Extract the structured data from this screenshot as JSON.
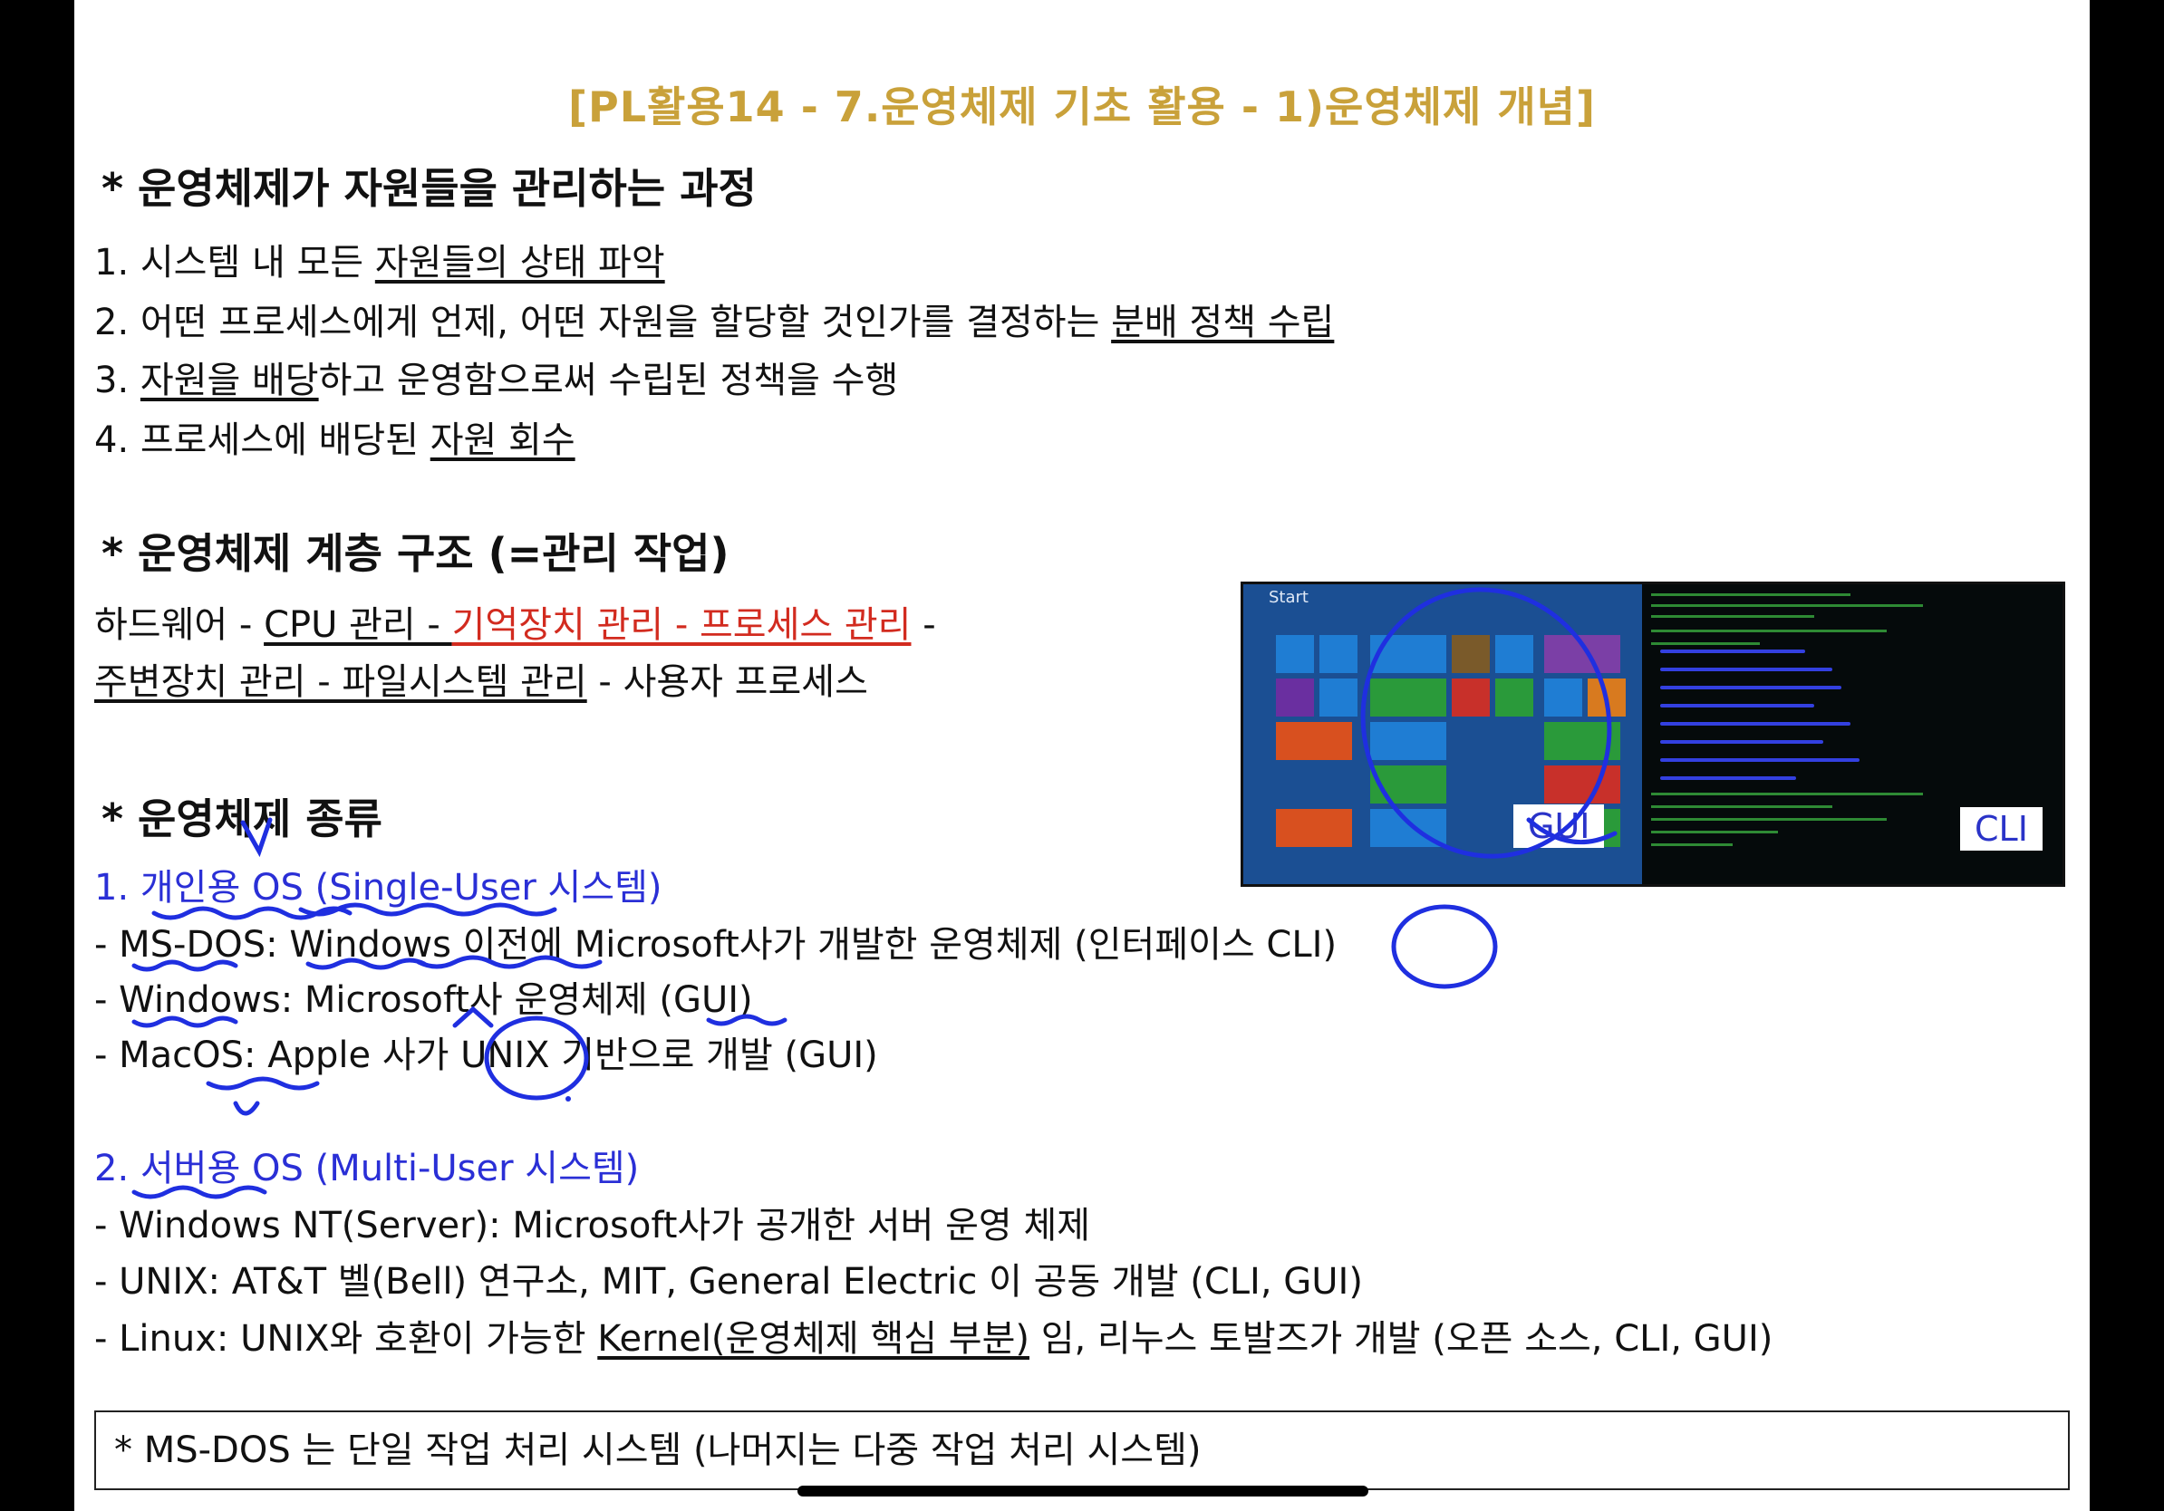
{
  "title": "[PL활용14 - 7.운영체제 기초 활용 - 1)운영체제 개념]",
  "section1": {
    "heading_star": "*",
    "heading": "운영체제가 자원들을 관리하는 과정",
    "items": [
      {
        "prefix": "1. 시스템 내 모든 ",
        "u": "자원들의 상태 파악",
        "suffix": ""
      },
      {
        "prefix": "2. 어떤 프로세스에게 언제, 어떤 자원을 할당할 것인가를 결정하는 ",
        "u": "분배 정책 수립",
        "suffix": ""
      },
      {
        "prefix": "3. ",
        "u": "자원을 배당",
        "suffix": "하고 운영함으로써 수립된 정책을 수행"
      },
      {
        "prefix": "4. 프로세스에 배당된 ",
        "u": "자원 회수",
        "suffix": ""
      }
    ]
  },
  "section2": {
    "heading_star": "*",
    "heading": "운영체제 계층 구조 (=관리 작업)",
    "line1": {
      "a": "하드웨어 - ",
      "b": "CPU 관리 - ",
      "c": "기억장치 관리 - 프로세스 관리",
      "d": " -"
    },
    "line2": {
      "a": "주변장치 관리 - 파일시스템 관리",
      "b": " - 사용자 프로세스"
    }
  },
  "section3": {
    "heading_star": "*",
    "heading": "운영체제 종류",
    "personal_heading": "1. 개인용 OS (Single-User 시스템)",
    "personal_items": [
      "- MS-DOS: Windows 이전에 Microsoft사가 개발한 운영체제 (인터페이스 CLI)",
      "- Windows: Microsoft사 운영체제 (GUI)",
      "- MacOS: Apple 사가 UNIX 기반으로 개발 (GUI)"
    ],
    "server_heading": "2. 서버용 OS (Multi-User 시스템)",
    "server_items": [
      "- Windows NT(Server): Microsoft사가 공개한 서버 운영 체제",
      "- UNIX: AT&T 벨(Bell) 연구소, MIT, General Electric 이 공동 개발 (CLI, GUI)"
    ],
    "linux": {
      "prefix": "- Linux: UNIX와 호환이 가능한 ",
      "u": "Kernel(운영체제 핵심 부분)",
      "suffix": " 임, 리누스 토발즈가 개발 (오픈 소스, CLI, GUI)"
    }
  },
  "screenshot": {
    "start_label": "Start",
    "gui_tag": "GUI",
    "cli_tag": "CLI"
  },
  "note": "* MS-DOS 는 단일 작업 처리 시스템 (나머지는 다중 작업 처리 시스템)",
  "colors": {
    "title": "#c9a13a",
    "red": "#d22b1f",
    "blue": "#2a2fd6",
    "ink": "#1f2fe0"
  }
}
